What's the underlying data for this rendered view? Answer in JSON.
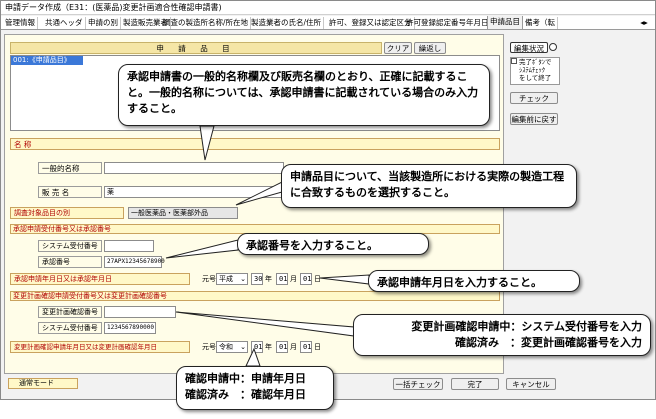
{
  "window": {
    "title": "申請データ作成（E31：(医薬品)変更計画適合性確認申請書)"
  },
  "tabs": [
    "管理情報",
    "共通ヘッダ",
    "申請の別",
    "製造販売業者",
    "調査の製造所名称/所在地",
    "製造業者の氏名/住所",
    "許可、登録又は認定区分",
    "許可登録認定番号年月日",
    "申請品目",
    "備考（転"
  ],
  "active_tab_index": 8,
  "item_section": {
    "header": "申 請 品 目",
    "clear": "クリア",
    "repeat": "繰返し",
    "list_item": "001:《申請品目》"
  },
  "side": {
    "edit_status": "編集状況",
    "complete_hint": "完了ﾎﾞﾀﾝで\nｼｽﾃﾑﾁｪｯｸ\nをして終了",
    "check": "チェック",
    "revert": "編集前に戻す"
  },
  "form": {
    "name_label": "名 称",
    "general_name_label": "一般的名称",
    "brand_name_label": "販 売 名",
    "brand_name_value": "薬",
    "category_label": "調査対象品目の別",
    "category_value": "一般医薬品・医薬部外品",
    "approval_section": "承認申請受付番号又は承認番号",
    "system_number_label": "システム受付番号",
    "approval_number_label": "承認番号",
    "approval_number_value": "27APX12345678900",
    "approval_date_label": "承認申請年月日又は承認年月日",
    "era_label": "元号",
    "era_value": "平成",
    "year_value": "30",
    "year_unit": "年",
    "month_value": "01",
    "month_unit": "月",
    "day_value": "01",
    "day_unit": "日",
    "change_section": "変更計画確認申請受付番号又は変更計画確認番号",
    "change_number_label": "変更計画確認番号",
    "system_number2_label": "システム受付番号",
    "system_number2_value": "1234567890000",
    "change_date_label": "変更計画確認申請年月日又は変更計画確認年月日",
    "era2_value": "令和",
    "year2_value": "01",
    "month2_value": "01",
    "day2_value": "01"
  },
  "footer": {
    "mode": "通常モード",
    "batch_check": "一括チェック",
    "done": "完了",
    "cancel": "キャンセル"
  },
  "callouts": {
    "c1": "承認申請書の一般的名称欄及び販売名欄のとおり、正確に記載すること。一般的名称については、承認申請書に記載されている場合のみ入力すること。",
    "c2": "申請品目について、当該製造所における実際の製造工程に合致するものを選択すること。",
    "c3": "承認番号を入力すること。",
    "c4": "承認申請年月日を入力すること。",
    "c5_line1": "変更計画確認申請中：システム受付番号を入力",
    "c5_line2": "確認済み　：変更計画確認番号を入力",
    "c6_line1": "確認申請中：申請年月日",
    "c6_line2": "確認済み　：確認年月日"
  }
}
